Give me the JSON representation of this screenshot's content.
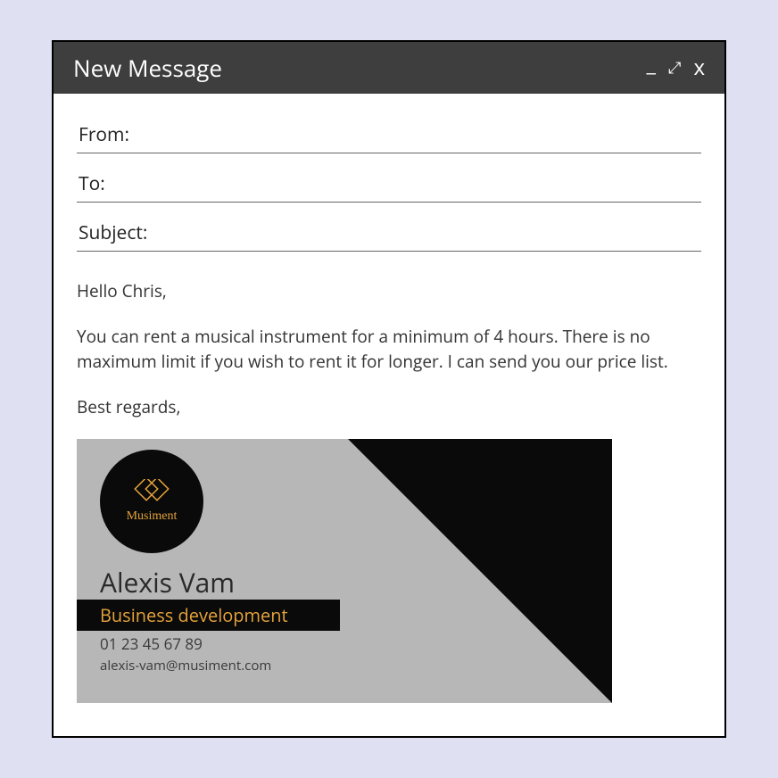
{
  "header": {
    "title": "New Message"
  },
  "fields": {
    "from_label": "From:",
    "to_label": "To:",
    "subject_label": "Subject:"
  },
  "body": {
    "greeting": "Hello Chris,",
    "paragraph": "You can rent a musical instrument for a minimum of 4 hours. There is no maximum limit if you wish to rent it for longer. I can send you our price list.",
    "signoff": "Best regards,"
  },
  "signature": {
    "company": "Musiment",
    "name": "Alexis Vam",
    "role": "Business development",
    "phone": "01 23 45 67 89",
    "email": "alexis-vam@musiment.com"
  },
  "colors": {
    "accent": "#e4a23b",
    "dark": "#0a0a0a",
    "page_bg": "#dfe1f3",
    "sig_bg": "#b7b7b7"
  }
}
